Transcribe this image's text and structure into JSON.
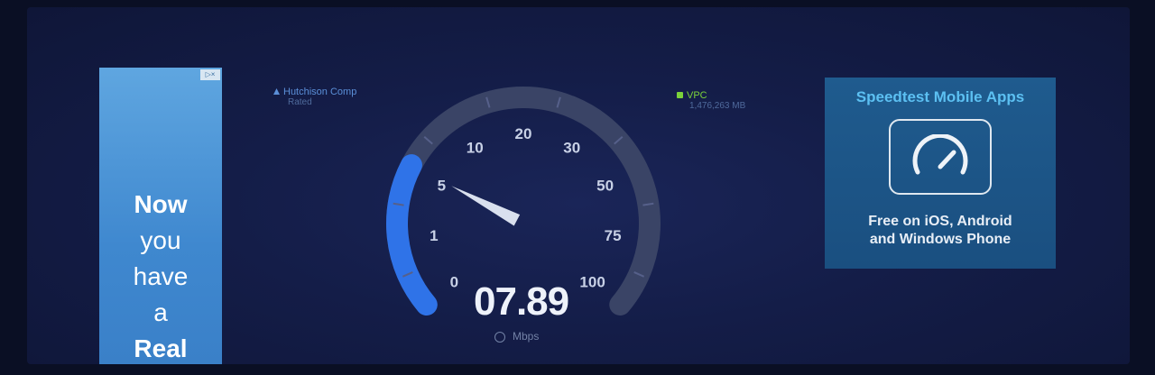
{
  "left_ad": {
    "lines": [
      "Now",
      "you",
      "have",
      "a",
      "Real"
    ]
  },
  "connection": {
    "isp_name": "Hutchison Comp",
    "isp_sub": "Rated",
    "server_name": "VPC",
    "server_sub": "1,476,263 MB"
  },
  "gauge": {
    "tick_labels": [
      "0",
      "1",
      "5",
      "10",
      "20",
      "30",
      "50",
      "75",
      "100"
    ],
    "speed": "07.89",
    "unit": "Mbps",
    "progress_fraction": 0.26
  },
  "right_ad": {
    "title": "Speedtest Mobile Apps",
    "icon": "speedometer-icon",
    "desc_line1": "Free on iOS, Android",
    "desc_line2": "and Windows Phone"
  },
  "colors": {
    "accent": "#2f73e8",
    "background": "#141d48",
    "server_dot": "#7ad23a"
  }
}
